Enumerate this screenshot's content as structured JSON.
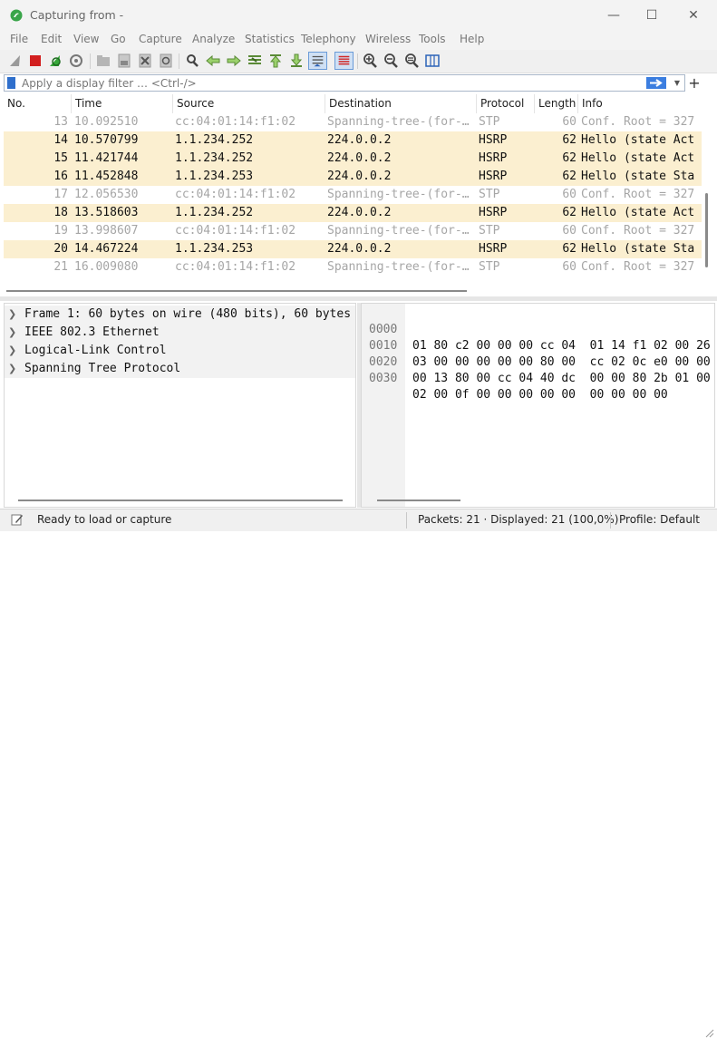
{
  "window": {
    "title": "Capturing from -",
    "controls": {
      "minimize": "—",
      "maximize": "☐",
      "close": "✕"
    }
  },
  "menu": [
    "File",
    "Edit",
    "View",
    "Go",
    "Capture",
    "Analyze",
    "Statistics",
    "Telephony",
    "Wireless",
    "Tools",
    "Help"
  ],
  "toolbar": {
    "icons": [
      "shark-fin-start-icon",
      "stop-capture-icon",
      "restart-capture-icon",
      "capture-options-icon",
      "open-file-icon",
      "save-file-icon",
      "close-file-icon",
      "reload-file-icon",
      "find-packet-icon",
      "go-back-icon",
      "go-forward-icon",
      "go-to-packet-icon",
      "go-first-icon",
      "go-last-icon",
      "autoscroll-icon",
      "colorize-icon",
      "zoom-in-icon",
      "zoom-out-icon",
      "normal-size-icon",
      "resize-columns-icon"
    ]
  },
  "filter": {
    "placeholder": "Apply a display filter … <Ctrl-/>",
    "value": "",
    "add_label": "+"
  },
  "packet_list": {
    "columns": [
      "No.",
      "Time",
      "Source",
      "Destination",
      "Protocol",
      "Length",
      "Info"
    ],
    "rows": [
      {
        "no": "13",
        "time": "10.092510",
        "src": "cc:04:01:14:f1:02",
        "dst": "Spanning-tree-(for-…",
        "proto": "STP",
        "len": "60",
        "info": "Conf. Root = 327",
        "kind": "stp"
      },
      {
        "no": "14",
        "time": "10.570799",
        "src": "1.1.234.252",
        "dst": "224.0.0.2",
        "proto": "HSRP",
        "len": "62",
        "info": "Hello (state Act",
        "kind": "hsrp"
      },
      {
        "no": "15",
        "time": "11.421744",
        "src": "1.1.234.252",
        "dst": "224.0.0.2",
        "proto": "HSRP",
        "len": "62",
        "info": "Hello (state Act",
        "kind": "hsrp"
      },
      {
        "no": "16",
        "time": "11.452848",
        "src": "1.1.234.253",
        "dst": "224.0.0.2",
        "proto": "HSRP",
        "len": "62",
        "info": "Hello (state Sta",
        "kind": "hsrp"
      },
      {
        "no": "17",
        "time": "12.056530",
        "src": "cc:04:01:14:f1:02",
        "dst": "Spanning-tree-(for-…",
        "proto": "STP",
        "len": "60",
        "info": "Conf. Root = 327",
        "kind": "stp"
      },
      {
        "no": "18",
        "time": "13.518603",
        "src": "1.1.234.252",
        "dst": "224.0.0.2",
        "proto": "HSRP",
        "len": "62",
        "info": "Hello (state Act",
        "kind": "hsrp"
      },
      {
        "no": "19",
        "time": "13.998607",
        "src": "cc:04:01:14:f1:02",
        "dst": "Spanning-tree-(for-…",
        "proto": "STP",
        "len": "60",
        "info": "Conf. Root = 327",
        "kind": "stp"
      },
      {
        "no": "20",
        "time": "14.467224",
        "src": "1.1.234.253",
        "dst": "224.0.0.2",
        "proto": "HSRP",
        "len": "62",
        "info": "Hello (state Sta",
        "kind": "hsrp"
      },
      {
        "no": "21",
        "time": "16.009080",
        "src": "cc:04:01:14:f1:02",
        "dst": "Spanning-tree-(for-…",
        "proto": "STP",
        "len": "60",
        "info": "Conf. Root = 327",
        "kind": "stp"
      }
    ]
  },
  "details": {
    "items": [
      "Frame 1: 60 bytes on wire (480 bits), 60 bytes",
      "IEEE 802.3 Ethernet",
      "Logical-Link Control",
      "Spanning Tree Protocol"
    ]
  },
  "bytes": {
    "rows": [
      {
        "offset": "0000",
        "hex": "01 80 c2 00 00 00 cc 04  01 14 f1 02 00 26"
      },
      {
        "offset": "0010",
        "hex": "03 00 00 00 00 00 80 00  cc 02 0c e0 00 00"
      },
      {
        "offset": "0020",
        "hex": "00 13 80 00 cc 04 40 dc  00 00 80 2b 01 00"
      },
      {
        "offset": "0030",
        "hex": "02 00 0f 00 00 00 00 00  00 00 00 00"
      }
    ]
  },
  "status": {
    "ready": "Ready to load or capture",
    "packets": "Packets: 21 · Displayed: 21 (100,0%)",
    "profile": "Profile: Default"
  },
  "colors": {
    "hsrp_row": "#fbefd0",
    "stp_text": "#a6a6a6",
    "accent": "#3b7ee0"
  }
}
